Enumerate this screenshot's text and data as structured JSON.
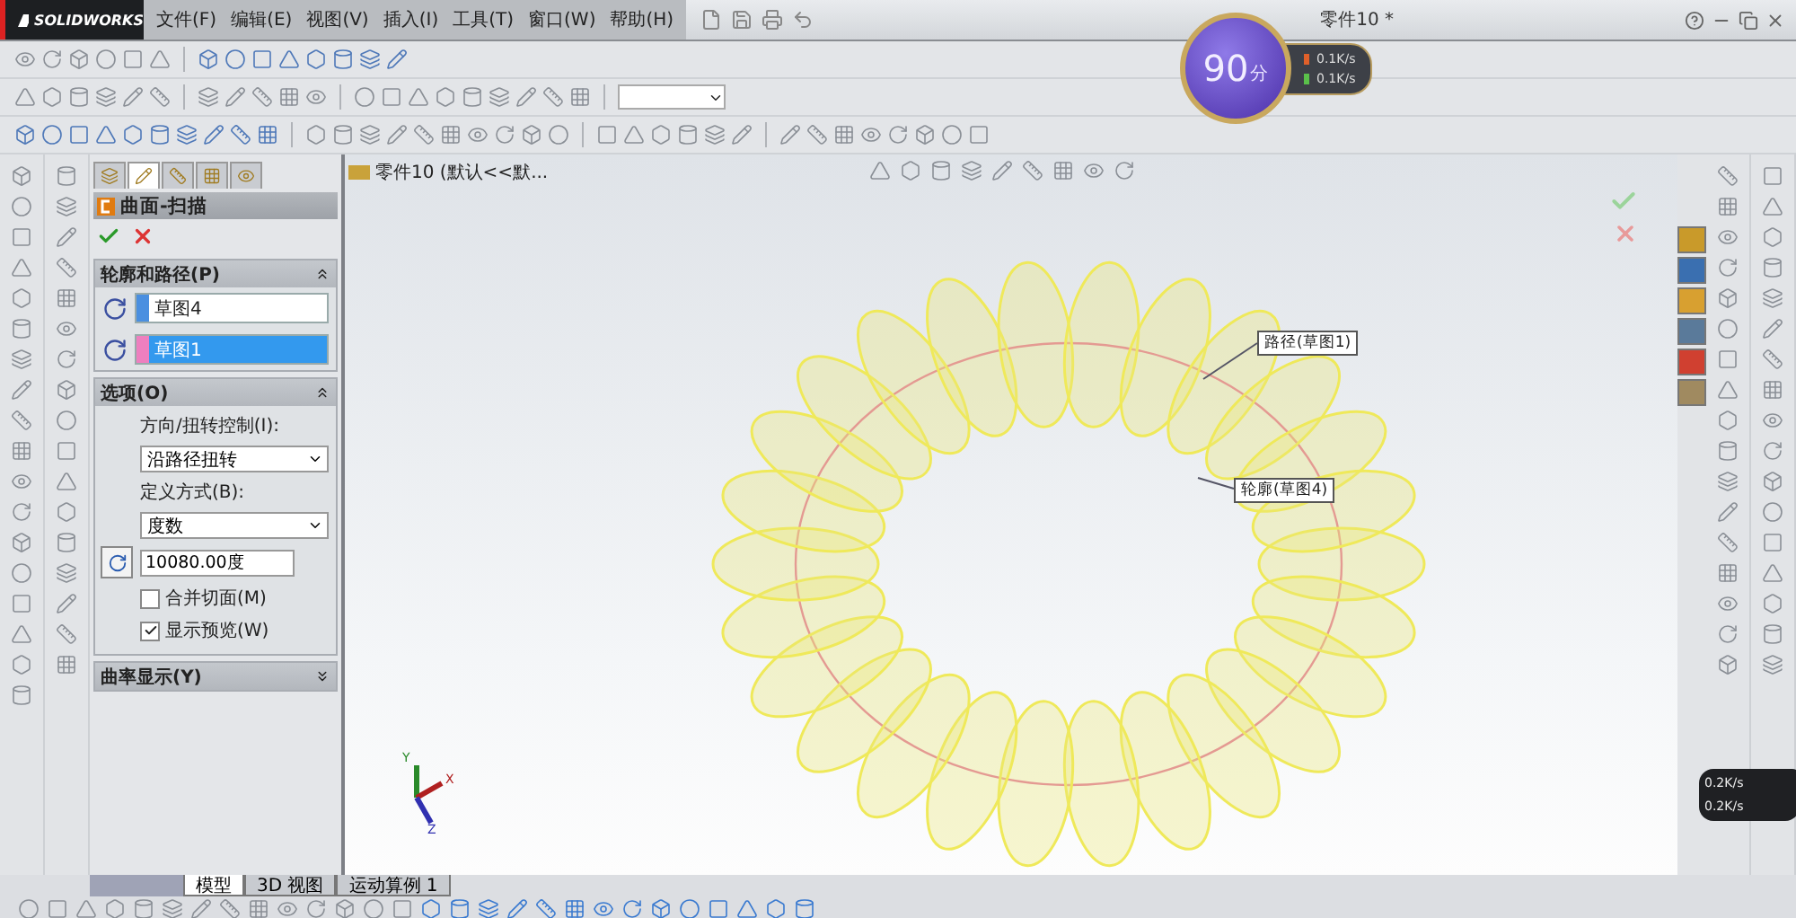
{
  "app": {
    "logo": "SOLIDWORKS",
    "menus": [
      "文件(F)",
      "编辑(E)",
      "视图(V)",
      "插入(I)",
      "工具(T)",
      "窗口(W)",
      "帮助(H)"
    ],
    "title": "零件10 *"
  },
  "speed_widget": {
    "score": "90",
    "unit": "分",
    "upload": "0.1K/s",
    "download": "0.1K/s"
  },
  "property_manager": {
    "tabs": [
      {
        "selected": false
      },
      {
        "selected": true
      },
      {
        "selected": false
      },
      {
        "selected": false
      },
      {
        "selected": false
      }
    ],
    "title": "曲面-扫描",
    "sections": [
      {
        "title": "轮廓和路径(P)",
        "expanded": true,
        "selections": [
          {
            "label": "草图4",
            "color": "#4a8fe0",
            "selected": false
          },
          {
            "label": "草图1",
            "color": "#ee7fbf",
            "selected": true
          }
        ]
      },
      {
        "title": "选项(O)",
        "expanded": true,
        "fields": [
          {
            "kind": "label",
            "text": "方向/扭转控制(I):"
          },
          {
            "kind": "select",
            "value": "沿路径扭转"
          },
          {
            "kind": "label",
            "text": "定义方式(B):"
          },
          {
            "kind": "select",
            "value": "度数"
          },
          {
            "kind": "number",
            "value": "10080.00度"
          },
          {
            "kind": "checkbox",
            "label": "合并切面(M)",
            "checked": false
          },
          {
            "kind": "checkbox",
            "label": "显示预览(W)",
            "checked": true
          }
        ]
      },
      {
        "title": "曲率显示(Y)",
        "expanded": false
      }
    ]
  },
  "viewport": {
    "tree_label": "零件10 (默认<<默...",
    "callouts": [
      {
        "text": "路径(草图1)"
      },
      {
        "text": "轮廓(草图4)"
      }
    ],
    "axes": [
      "X",
      "Y",
      "Z"
    ]
  },
  "bottom_tabs": [
    {
      "label": "模型",
      "selected": true
    },
    {
      "label": "3D 视图",
      "selected": false
    },
    {
      "label": "运动算例 1",
      "selected": false
    }
  ],
  "tray_widget": {
    "upload": "0.2K/s",
    "download": "0.2K/s"
  }
}
